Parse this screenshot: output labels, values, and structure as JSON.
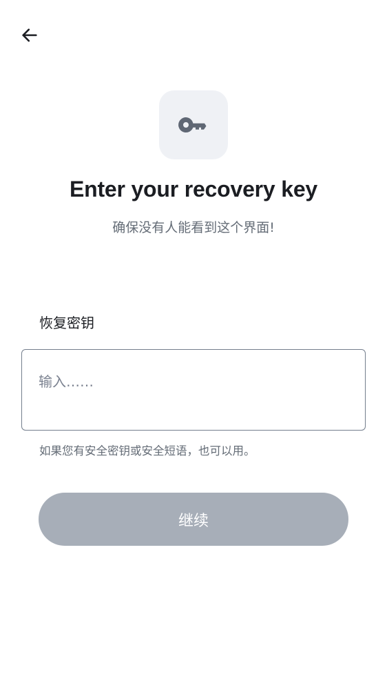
{
  "header": {
    "back_icon": "arrow-left-icon"
  },
  "hero": {
    "icon": "key-icon",
    "title": "Enter your recovery key",
    "subtitle": "确保没有人能看到这个界面!"
  },
  "form": {
    "field_label": "恢复密钥",
    "input_placeholder": "输入……",
    "input_value": "",
    "hint": "如果您有安全密钥或安全短语，也可以用。",
    "continue_label": "继续",
    "continue_enabled": false
  },
  "colors": {
    "icon_tile_bg": "#eff1f5",
    "icon_color": "#5f6774",
    "disabled_button_bg": "#a7aeb8",
    "input_border": "#737d8c"
  }
}
